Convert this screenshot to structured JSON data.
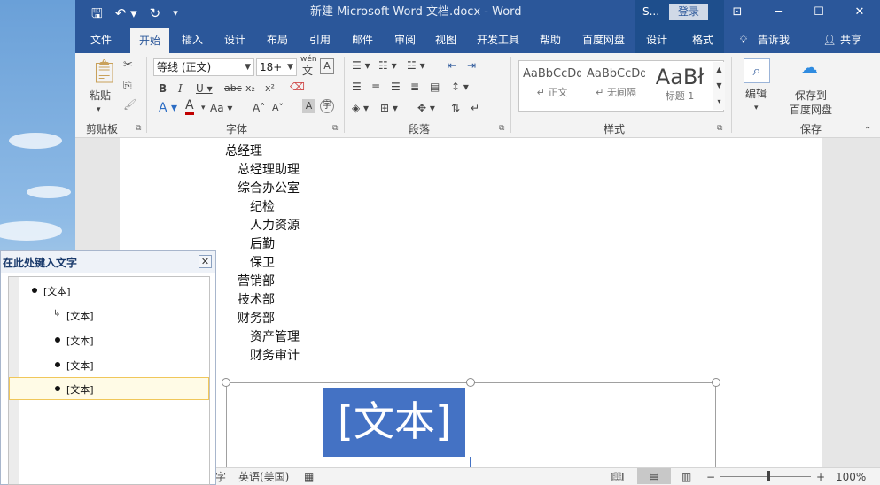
{
  "window": {
    "title": "新建 Microsoft Word 文档.docx  -  Word"
  },
  "context": {
    "label": "S...",
    "login": "登录"
  },
  "tabs": [
    {
      "label": "文件"
    },
    {
      "label": "开始"
    },
    {
      "label": "插入"
    },
    {
      "label": "设计"
    },
    {
      "label": "布局"
    },
    {
      "label": "引用"
    },
    {
      "label": "邮件"
    },
    {
      "label": "审阅"
    },
    {
      "label": "视图"
    },
    {
      "label": "开发工具"
    },
    {
      "label": "帮助"
    },
    {
      "label": "百度网盘"
    },
    {
      "label": "设计"
    },
    {
      "label": "格式"
    },
    {
      "label": "告诉我"
    },
    {
      "label": "共享"
    }
  ],
  "ribbon": {
    "clipboard": {
      "paste": "粘贴",
      "label": "剪贴板"
    },
    "font": {
      "name": "等线 (正文)",
      "size": "18+",
      "label": "字体",
      "wen": "wén",
      "wen_char": "文"
    },
    "paragraph": {
      "label": "段落"
    },
    "styles": {
      "label": "样式",
      "items": [
        {
          "preview": "AaBbCcDd",
          "name": "↵ 正文"
        },
        {
          "preview": "AaBbCcDd",
          "name": "↵ 无间隔"
        },
        {
          "preview": "AaBł",
          "name": "标题 1"
        }
      ]
    },
    "edit": {
      "label": "编辑"
    },
    "save": {
      "line1": "保存到",
      "line2": "百度网盘",
      "label": "保存"
    }
  },
  "document": {
    "outline": [
      "总经理",
      "总经理助理",
      "综合办公室",
      "纪检",
      "人力资源",
      "后勤",
      "保卫",
      "营销部",
      "技术部",
      "财务部",
      "资产管理",
      "财务审计"
    ],
    "smartart_text": "[文本]"
  },
  "textpane": {
    "title": "在此处键入文字",
    "close": "✕",
    "items": [
      {
        "text": "[文本]"
      },
      {
        "text": "[文本]"
      },
      {
        "text": "[文本]"
      },
      {
        "text": "[文本]"
      },
      {
        "text": "[文本]"
      }
    ]
  },
  "status": {
    "language": "英语(美国)",
    "zoom": "100%",
    "lang_prefix": "字"
  }
}
